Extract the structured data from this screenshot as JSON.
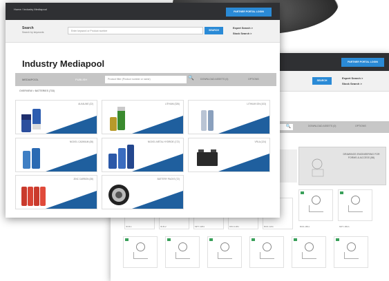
{
  "back_window": {
    "partner_button": "PARTNER PORTAL LOGIN",
    "search_button": "SEARCH",
    "links": [
      "Expert Search >",
      "Stock Search >"
    ],
    "filter_download": "DOWNLOAD ASSETS (0)",
    "filter_options": "OPTIONS",
    "drawing_label": "DRAWINGS ENGINEERING FOR FORMS & ACCESS (58)",
    "thumb_captions": [
      "ID-B-1",
      "ID-B-2",
      "MPY-11B1",
      "DW-9-1B1",
      "BCD-1211",
      "BCD-1B11",
      "MPY-1B1A"
    ]
  },
  "front_window": {
    "breadcrumb_top": "Home / Industry Mediapool",
    "partner_button": "PARTNER PORTAL LOGIN",
    "search": {
      "label": "Search",
      "sublabel": "Search by keywords",
      "placeholder": "Enter keyword or Product number",
      "button": "SEARCH"
    },
    "links": [
      "Expert Search >",
      "Stock Search >"
    ],
    "title": "Industry Mediapool",
    "filter": {
      "mediapool": "MEDIAPOOL",
      "publish": "PUBLISH",
      "search_placeholder": "Product filter (Product number or name)",
      "download": "DOWNLOAD ASSETS (0)",
      "options": "OPTIONS"
    },
    "breadcrumb": "OVERVIEW > BATTERIES (733)",
    "tiles": [
      {
        "label": "ALKALINE (22)"
      },
      {
        "label": "LITHIUM (326)"
      },
      {
        "label": "LITHIUM ION (103)"
      },
      {
        "label": "NICKEL CADMIUM (38)"
      },
      {
        "label": "NICKEL METAL HYDRIDE (172)"
      },
      {
        "label": "VRLA (124)"
      },
      {
        "label": "ZINC CARBON (38)"
      },
      {
        "label": "BATTERY PACKS (72)"
      }
    ]
  }
}
